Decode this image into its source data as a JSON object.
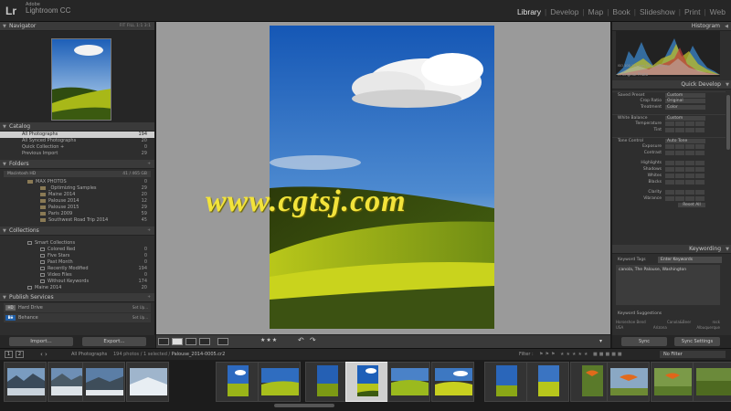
{
  "topbar": {
    "logo": "Lr",
    "vendor": "Adobe",
    "app_name": "Lightroom CC",
    "modules": [
      "Library",
      "Develop",
      "Map",
      "Book",
      "Slideshow",
      "Print",
      "Web"
    ],
    "active_module": "Library"
  },
  "left_panel": {
    "navigator": {
      "title": "Navigator",
      "zoom_options": "FIT  FILL  1:1  3:1"
    },
    "catalog": {
      "title": "Catalog",
      "items": [
        {
          "label": "All Photographs",
          "count": "194"
        },
        {
          "label": "All Synced Photographs",
          "count": "20"
        },
        {
          "label": "Quick Collection +",
          "count": "0"
        },
        {
          "label": "Previous Import",
          "count": "29"
        }
      ]
    },
    "folders": {
      "title": "Folders",
      "drive": "Macintosh HD",
      "drive_info": "41 / 465 GB",
      "items": [
        {
          "label": "MAX PHOTOS",
          "count": "0"
        },
        {
          "label": "_Optimizing Samples",
          "count": "29"
        },
        {
          "label": "Maine 2014",
          "count": "20"
        },
        {
          "label": "Palouse 2014",
          "count": "12"
        },
        {
          "label": "Palouse 2015",
          "count": "29"
        },
        {
          "label": "Paris 2009",
          "count": "59"
        },
        {
          "label": "Southwest Road Trip 2014",
          "count": "45"
        }
      ]
    },
    "collections": {
      "title": "Collections",
      "items": [
        {
          "label": "Smart Collections",
          "count": ""
        },
        {
          "label": "Colored Red",
          "count": "0"
        },
        {
          "label": "Five Stars",
          "count": "0"
        },
        {
          "label": "Past Month",
          "count": "0"
        },
        {
          "label": "Recently Modified",
          "count": "194"
        },
        {
          "label": "Video Files",
          "count": "0"
        },
        {
          "label": "Without Keywords",
          "count": "174"
        },
        {
          "label": "Maine 2014",
          "count": "20"
        }
      ]
    },
    "publish": {
      "title": "Publish Services",
      "services": [
        {
          "icon": "HD",
          "label": "Hard Drive",
          "setup": "Set Up..."
        },
        {
          "icon": "Bē",
          "label": "Behance",
          "setup": "Set Up..."
        }
      ]
    },
    "import_label": "Import...",
    "export_label": "Export..."
  },
  "toolbar": {
    "rating": "★★★"
  },
  "watermark": "www.cgtsj.com",
  "right_panel": {
    "histogram": {
      "title": "Histogram",
      "info": "ISO 100    105 mm    f/8.0    1/250 sec",
      "original_photo": "Original Photo"
    },
    "quick_develop": {
      "title": "Quick Develop",
      "saved_preset_label": "Saved Preset",
      "saved_preset_value": "Custom",
      "crop_ratio_label": "Crop Ratio",
      "crop_ratio_value": "Original",
      "treatment_label": "Treatment",
      "treatment_value": "Color",
      "white_balance_label": "White Balance",
      "white_balance_value": "Custom",
      "temperature_label": "Temperature",
      "tint_label": "Tint",
      "tone_control_label": "Tone Control",
      "auto_tone_label": "Auto Tone",
      "exposure_label": "Exposure",
      "contrast_label": "Contrast",
      "highlights_label": "Highlights",
      "shadows_label": "Shadows",
      "whites_label": "Whites",
      "blacks_label": "Blacks",
      "clarity_label": "Clarity",
      "vibrance_label": "Vibrance",
      "reset_all_label": "Reset All"
    },
    "keywording": {
      "title": "Keywording",
      "keyword_tags_label": "Keyword Tags",
      "keyword_tags_value": "Enter Keywords",
      "keywords": "canola, The Palouse, Washington",
      "suggestions_title": "Keyword Suggestions",
      "suggestions": [
        "Horseshoe Bend",
        "Canola&Beer",
        "rock",
        "USA",
        "Arizona",
        "Albuquerque"
      ]
    },
    "sync_label": "Sync",
    "sync_settings_label": "Sync Settings"
  },
  "filmstrip": {
    "page1": "1",
    "page2": "2",
    "source": "All Photographs",
    "info_prefix": "194 photos / 1 selected /",
    "filename": "Palouse_2014-0005.cr2",
    "filter_label": "Filter :",
    "filter_value": "No Filter"
  }
}
